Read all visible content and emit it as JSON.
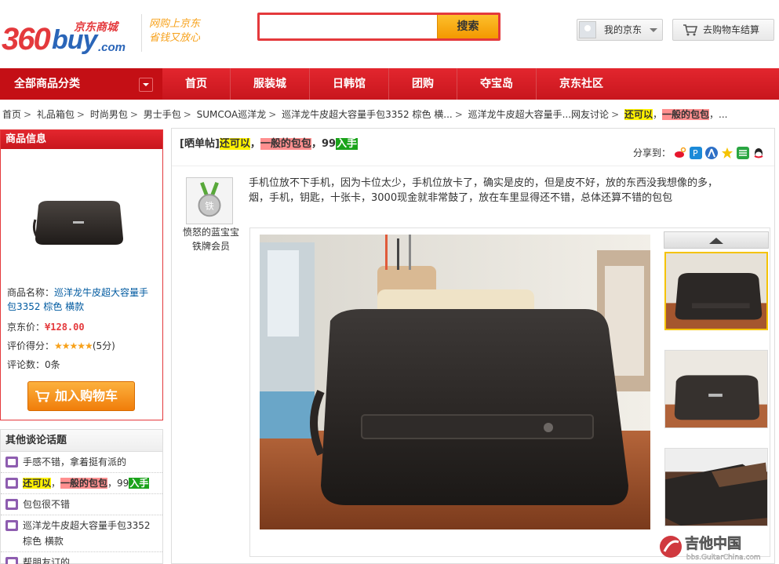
{
  "header": {
    "logo_360": "360",
    "logo_buy": "buy",
    "logo_cn": "京东商城",
    "logo_com": ".com",
    "slogan_line1": "网购上京东",
    "slogan_line2": "省钱又放心",
    "search_placeholder": "",
    "search_button": "搜索",
    "my_jd": "我的京东",
    "cart_checkout": "去购物车结算"
  },
  "nav": {
    "all_categories": "全部商品分类",
    "items": [
      "首页",
      "服装城",
      "日韩馆",
      "团购",
      "夺宝岛",
      "京东社区"
    ]
  },
  "breadcrumb": {
    "items": [
      "首页",
      "礼品箱包",
      "时尚男包",
      "男士手包",
      "SUMCOA巡洋龙",
      "巡洋龙牛皮超大容量手包3352 棕色 横...",
      "巡洋龙牛皮超大容量手...网友讨论"
    ],
    "hl1": "还可以",
    "comma": "，",
    "hl2": "一般的包包",
    "tail": "，..."
  },
  "product": {
    "header": "商品信息",
    "name_label": "商品名称：",
    "name": "巡洋龙牛皮超大容量手包3352 棕色 横款",
    "price_label": "京东价：",
    "price": "¥128.00",
    "rating_label": "评价得分：",
    "stars": "★★★★★",
    "rating_value": "(5分)",
    "reviews_label": "评论数：",
    "reviews_count": "0条",
    "add_to_cart": "加入购物车"
  },
  "topics": {
    "header": "其他谈论话题",
    "items": [
      {
        "text": "手感不错，拿着挺有派的"
      },
      {
        "hl1": "还可以",
        "hl2": "一般的包包",
        "n": "，99",
        "g": "入手"
      },
      {
        "text": "包包很不错"
      },
      {
        "text": "巡洋龙牛皮超大容量手包3352 棕色 横款"
      },
      {
        "text": "帮朋友订的"
      }
    ]
  },
  "post": {
    "tag": "[晒单帖]",
    "hl1": "还可以",
    "comma": "，",
    "hl2": "一般的包包",
    "num": "，99",
    "green": "入手",
    "share_label": "分享到：",
    "author": "愤怒的蓝宝宝",
    "level": "铁牌会员",
    "badge": "铁",
    "body": "手机位放不下手机，因为卡位太少，手机位放卡了，确实是皮的，但是皮不好，放的东西没我想像的多，烟，手机，钥匙，十张卡，3000现金就非常鼓了，放在车里显得还不错，总体还算不错的包包"
  },
  "watermark": {
    "text": "吉他中国",
    "url": "bbs.GuitarChina.com"
  },
  "colors": {
    "brand_red": "#e4393c",
    "nav_red": "#c8161d",
    "link_blue": "#005aa0",
    "accent_orange": "#f39800"
  }
}
